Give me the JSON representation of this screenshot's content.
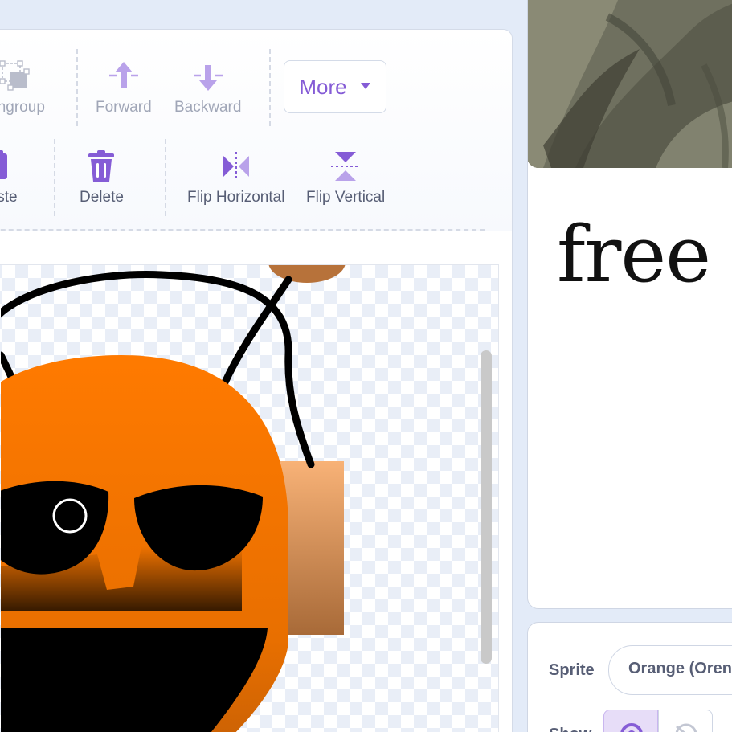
{
  "toolbar": {
    "row1": {
      "ungroup": "Ungroup",
      "forward": "Forward",
      "backward": "Backward",
      "more": "More"
    },
    "row2": {
      "paste": "Paste",
      "delete": "Delete",
      "flip_horizontal": "Flip Horizontal",
      "flip_vertical": "Flip Vertical"
    }
  },
  "stage": {
    "text": "free s"
  },
  "sprite_info": {
    "sprite_label": "Sprite",
    "sprite_name": "Orange (Oren)",
    "show_label": "Show"
  },
  "colors": {
    "accent": "#855cd6",
    "accent_light": "#b9a2ea",
    "sprite_orange": "#ff7a00",
    "text_gray": "#575e75"
  },
  "icons": {
    "ungroup": "ungroup-icon",
    "forward": "arrow-up-icon",
    "backward": "arrow-down-icon",
    "more": "caret-down-icon",
    "paste": "paste-icon",
    "delete": "trash-icon",
    "flip_horizontal": "flip-horizontal-icon",
    "flip_vertical": "flip-vertical-icon"
  }
}
